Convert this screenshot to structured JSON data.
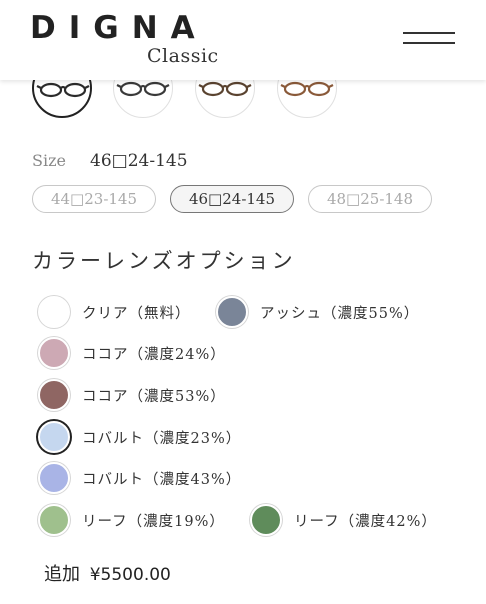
{
  "header": {
    "logo_main": "DIGNA",
    "logo_sub": "Classic"
  },
  "frames": [
    {
      "name": "black",
      "color": "#2b2b2b",
      "selected": true
    },
    {
      "name": "black-2",
      "color": "#3a3a3a",
      "selected": false
    },
    {
      "name": "brown",
      "color": "#5a4330",
      "selected": false
    },
    {
      "name": "tortoise",
      "color": "#8a5a3a",
      "selected": false
    }
  ],
  "size": {
    "label": "Size",
    "current": "46□24-145",
    "options": [
      {
        "label": "44□23-145",
        "selected": false
      },
      {
        "label": "46□24-145",
        "selected": true
      },
      {
        "label": "48□25-148",
        "selected": false
      }
    ]
  },
  "lens_section": {
    "title": "カラーレンズオプション",
    "options": [
      {
        "label": "クリア（無料）",
        "color": "#ffffff",
        "selected": false
      },
      {
        "label": "アッシュ（濃度55%）",
        "color": "#7a8598",
        "selected": false
      },
      {
        "label": "ココア（濃度24%）",
        "color": "#cda9b4",
        "selected": false
      },
      {
        "label": "ココア（濃度53%）",
        "color": "#8f6663",
        "selected": false
      },
      {
        "label": "コバルト（濃度23%）",
        "color": "#c5d7ef",
        "selected": true
      },
      {
        "label": "コバルト（濃度43%）",
        "color": "#a9b4e6",
        "selected": false
      },
      {
        "label": "リーフ（濃度19%）",
        "color": "#9fc08d",
        "selected": false
      },
      {
        "label": "リーフ（濃度42%）",
        "color": "#5f8c5b",
        "selected": false
      }
    ]
  },
  "price": {
    "label": "追加",
    "value": "¥5500.00"
  }
}
